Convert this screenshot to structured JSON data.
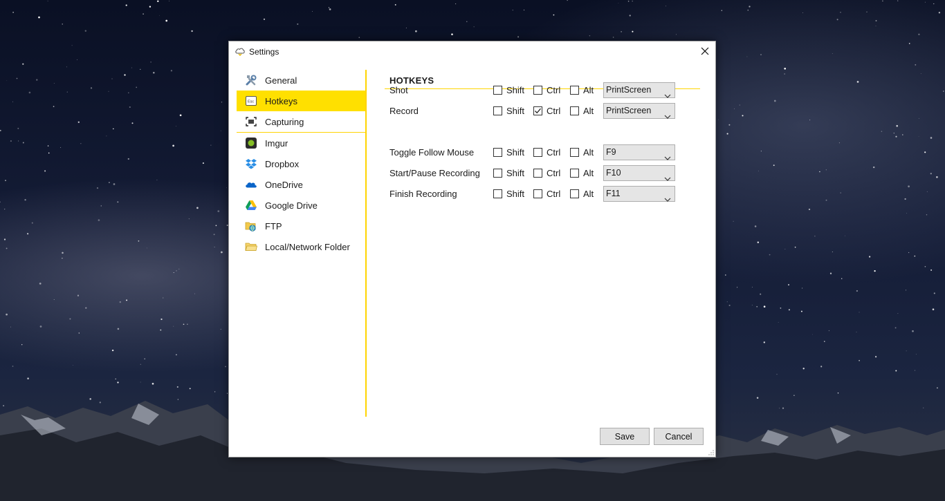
{
  "window": {
    "title": "Settings"
  },
  "sidebar": {
    "items": [
      {
        "label": "General",
        "icon": "tools-icon"
      },
      {
        "label": "Hotkeys",
        "icon": "esc-key-icon",
        "active": true
      },
      {
        "label": "Capturing",
        "icon": "capture-frame-icon"
      },
      {
        "label": "Imgur",
        "icon": "imgur-icon"
      },
      {
        "label": "Dropbox",
        "icon": "dropbox-icon"
      },
      {
        "label": "OneDrive",
        "icon": "onedrive-cloud-icon"
      },
      {
        "label": "Google Drive",
        "icon": "google-drive-icon"
      },
      {
        "label": "FTP",
        "icon": "ftp-folder-globe-icon"
      },
      {
        "label": "Local/Network Folder",
        "icon": "folder-icon"
      }
    ]
  },
  "hotkeys": {
    "section_title": "HOTKEYS",
    "modifier_labels": {
      "shift": "Shift",
      "ctrl": "Ctrl",
      "alt": "Alt"
    },
    "rows": [
      {
        "label": "Shot",
        "shift": false,
        "ctrl": false,
        "alt": false,
        "key": "PrintScreen"
      },
      {
        "label": "Record",
        "shift": false,
        "ctrl": true,
        "alt": false,
        "key": "PrintScreen"
      },
      {
        "label": "Toggle Follow Mouse",
        "shift": false,
        "ctrl": false,
        "alt": false,
        "key": "F9"
      },
      {
        "label": "Start/Pause Recording",
        "shift": false,
        "ctrl": false,
        "alt": false,
        "key": "F10"
      },
      {
        "label": "Finish Recording",
        "shift": false,
        "ctrl": false,
        "alt": false,
        "key": "F11"
      }
    ]
  },
  "buttons": {
    "save": "Save",
    "cancel": "Cancel"
  },
  "colors": {
    "accent": "#ffd400",
    "active_item": "#ffe000"
  }
}
